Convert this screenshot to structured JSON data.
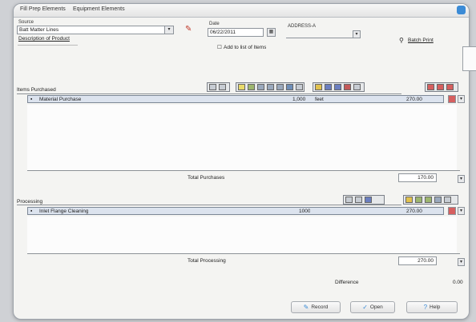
{
  "tabs": [
    "Fill Prep Elements",
    "Equipment Elements"
  ],
  "header": {
    "name_label": "Source",
    "name_value": "Batt Matter Lines",
    "subline": "Description of Product",
    "date_label": "Date",
    "date_value": "06/22/2011",
    "batch_label": "ADDRESS-A",
    "add_label": "Add to list of Items",
    "search_label": "Batch Print"
  },
  "section1": {
    "title": "Items Purchased",
    "row": {
      "name": "Material Purchase",
      "qty": "1,000",
      "unit": "feet",
      "amount": "270.00"
    },
    "total_label": "Total Purchases",
    "total_value": "170.00"
  },
  "section2": {
    "title": "Processing",
    "row": {
      "name": "Inlet Flange Cleaning",
      "qty": "1000",
      "amount": "270.00"
    },
    "total_label": "Total Processing",
    "total_value": "270.00"
  },
  "footer": {
    "diff_label": "Difference",
    "diff_value": "0.00"
  },
  "buttons": {
    "save": "Record",
    "reset": "Open",
    "help": "Help"
  },
  "colors": {
    "accent": "#3b8bd6",
    "selection": "#dce3ee"
  }
}
